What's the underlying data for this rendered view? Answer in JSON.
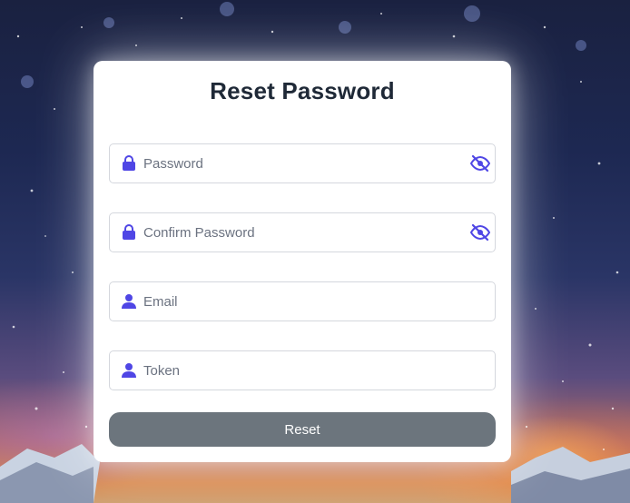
{
  "form": {
    "title": "Reset Password",
    "fields": [
      {
        "placeholder": "Password",
        "lead_icon": "lock-icon",
        "trail_icon": "eye-slash-icon"
      },
      {
        "placeholder": "Confirm Password",
        "lead_icon": "lock-icon",
        "trail_icon": "eye-slash-icon"
      },
      {
        "placeholder": "Email",
        "lead_icon": "user-icon"
      },
      {
        "placeholder": "Token",
        "lead_icon": "user-icon"
      }
    ],
    "submit_label": "Reset"
  },
  "colors": {
    "icon_accent": "#4f46e5",
    "button_bg": "#6c757d",
    "title_text": "#1f2937"
  }
}
